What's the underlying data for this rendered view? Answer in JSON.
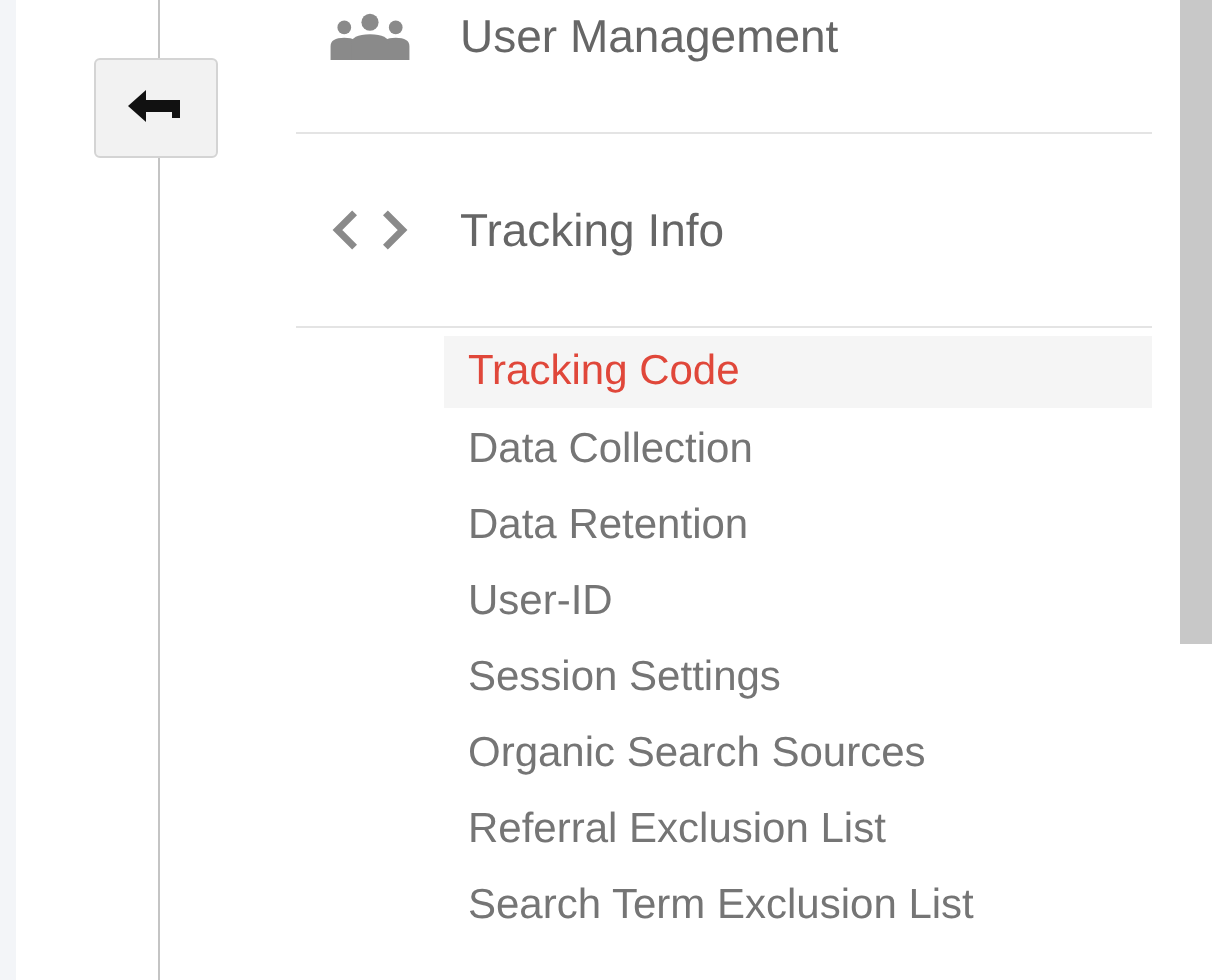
{
  "sections": [
    {
      "label": "User Management",
      "kind": "people"
    },
    {
      "label": "Tracking Info",
      "kind": "code"
    }
  ],
  "subitems": [
    {
      "label": "Tracking Code",
      "selected": true
    },
    {
      "label": "Data Collection",
      "selected": false
    },
    {
      "label": "Data Retention",
      "selected": false
    },
    {
      "label": "User-ID",
      "selected": false
    },
    {
      "label": "Session Settings",
      "selected": false
    },
    {
      "label": "Organic Search Sources",
      "selected": false
    },
    {
      "label": "Referral Exclusion List",
      "selected": false
    },
    {
      "label": "Search Term Exclusion List",
      "selected": false
    }
  ]
}
